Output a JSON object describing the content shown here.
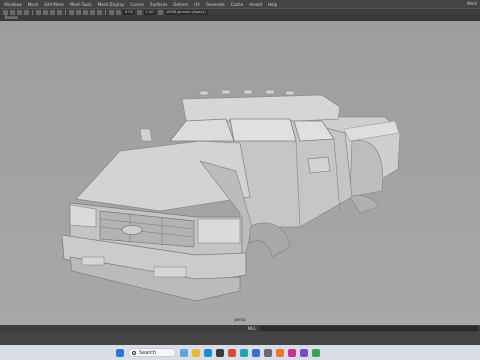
{
  "menu": [
    "Windows",
    "Mesh",
    "Edit Mesh",
    "Mesh Tools",
    "Mesh Display",
    "Curves",
    "Surfaces",
    "Deform",
    "UV",
    "Generate",
    "Cache",
    "Arnold",
    "Help"
  ],
  "menu_right": "Work",
  "toolbar": {
    "field1": "0.00",
    "field2": "1.00",
    "colorspace": "sRGB gamma (legacy)"
  },
  "panels_label": "Panels",
  "viewport": {
    "camera_label": "persp"
  },
  "cmdline": {
    "label": "MEL"
  },
  "taskbar": {
    "search_label": "Search",
    "icons": [
      "windows-start",
      "search",
      "widgets",
      "file-explorer",
      "edge-browser",
      "store",
      "chrome",
      "maya",
      "app-blue",
      "settings",
      "app-orange",
      "instagram",
      "app-purple",
      "app-green"
    ]
  },
  "colors": {
    "menubar": "#444444",
    "viewport": "#a3a3a3",
    "taskbar": "#d8dde7"
  }
}
